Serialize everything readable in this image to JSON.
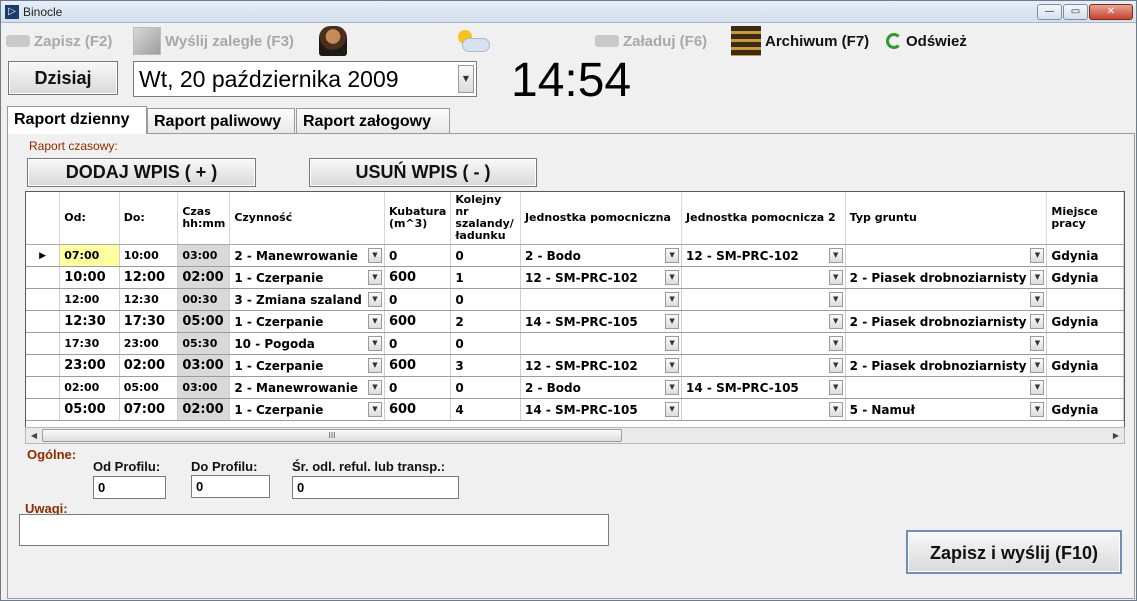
{
  "window": {
    "title": "Binocle",
    "min": "—",
    "max": "▭",
    "close": "✕"
  },
  "toolbar": {
    "save": "Zapisz (F2)",
    "send_pending": "Wyślij zaległe (F3)",
    "load": "Załaduj (F6)",
    "archive": "Archiwum (F7)",
    "refresh": "Odśwież"
  },
  "date": {
    "today_button": "Dzisiaj",
    "value": "Wt, 20 października 2009",
    "arrow": "▼",
    "clock": "14:54"
  },
  "tabs": [
    {
      "label": "Raport dzienny",
      "active": true
    },
    {
      "label": "Raport paliwowy",
      "active": false
    },
    {
      "label": "Raport załogowy",
      "active": false
    }
  ],
  "time_report": {
    "group_label": "Raport czasowy:",
    "add_button": "DODAJ WPIS ( + )",
    "remove_button": "USUŃ WPIS ( - )"
  },
  "grid": {
    "row_pointer": "▶",
    "dropdown_arrow": "▼",
    "columns": {
      "od": "Od:",
      "do": "Do:",
      "czas": "Czas hh:mm",
      "czynnosc": "Czynność",
      "kubatura": "Kubatura (m^3)",
      "kolejny": "Kolejny nr szalandy/ ładunku",
      "jedn1": "Jednostka pomocniczna",
      "jedn2": "Jednostka pomocnicza 2",
      "typ": "Typ gruntu",
      "miejsce": "Miejsce pracy"
    },
    "rows": [
      {
        "od": "07:00",
        "do": "10:00",
        "czas": "03:00",
        "czynnosc": "2 - Manewrowanie",
        "kubatura": "0",
        "kolejny": "0",
        "jedn1": "2 - Bodo",
        "jedn2": "12 - SM-PRC-102",
        "typ": "",
        "miejsce": "Gdynia",
        "big": false
      },
      {
        "od": "10:00",
        "do": "12:00",
        "czas": "02:00",
        "czynnosc": "1 - Czerpanie",
        "kubatura": "600",
        "kolejny": "1",
        "jedn1": "12 - SM-PRC-102",
        "jedn2": "",
        "typ": "2 - Piasek drobnoziarnisty",
        "miejsce": "Gdynia",
        "big": true
      },
      {
        "od": "12:00",
        "do": "12:30",
        "czas": "00:30",
        "czynnosc": "3 - Zmiana szaland",
        "kubatura": "0",
        "kolejny": "0",
        "jedn1": "",
        "jedn2": "",
        "typ": "",
        "miejsce": "",
        "big": false
      },
      {
        "od": "12:30",
        "do": "17:30",
        "czas": "05:00",
        "czynnosc": "1 - Czerpanie",
        "kubatura": "600",
        "kolejny": "2",
        "jedn1": "14 - SM-PRC-105",
        "jedn2": "",
        "typ": "2 - Piasek drobnoziarnisty",
        "miejsce": "Gdynia",
        "big": true
      },
      {
        "od": "17:30",
        "do": "23:00",
        "czas": "05:30",
        "czynnosc": "10 - Pogoda",
        "kubatura": "0",
        "kolejny": "0",
        "jedn1": "",
        "jedn2": "",
        "typ": "",
        "miejsce": "",
        "big": false
      },
      {
        "od": "23:00",
        "do": "02:00",
        "czas": "03:00",
        "czynnosc": "1 - Czerpanie",
        "kubatura": "600",
        "kolejny": "3",
        "jedn1": "12 - SM-PRC-102",
        "jedn2": "",
        "typ": "2 - Piasek drobnoziarnisty",
        "miejsce": "Gdynia",
        "big": true
      },
      {
        "od": "02:00",
        "do": "05:00",
        "czas": "03:00",
        "czynnosc": "2 - Manewrowanie",
        "kubatura": "0",
        "kolejny": "0",
        "jedn1": "2 - Bodo",
        "jedn2": "14 - SM-PRC-105",
        "typ": "",
        "miejsce": "",
        "big": false
      },
      {
        "od": "05:00",
        "do": "07:00",
        "czas": "02:00",
        "czynnosc": "1 - Czerpanie",
        "kubatura": "600",
        "kolejny": "4",
        "jedn1": "14 - SM-PRC-105",
        "jedn2": "",
        "typ": "5 - Namuł",
        "miejsce": "Gdynia",
        "big": true
      }
    ],
    "scroll": {
      "left": "◀",
      "right": "▶",
      "thumb": "III"
    }
  },
  "general": {
    "group_label": "Ogólne:",
    "od_profilu_label": "Od Profilu:",
    "od_profilu_value": "0",
    "do_profilu_label": "Do Profilu:",
    "do_profilu_value": "0",
    "sr_odl_label": "Śr. odl. reful. lub transp.:",
    "sr_odl_value": "0"
  },
  "remarks": {
    "group_label": "Uwagi:",
    "value": ""
  },
  "submit_button": "Zapisz i wyślij (F10)"
}
